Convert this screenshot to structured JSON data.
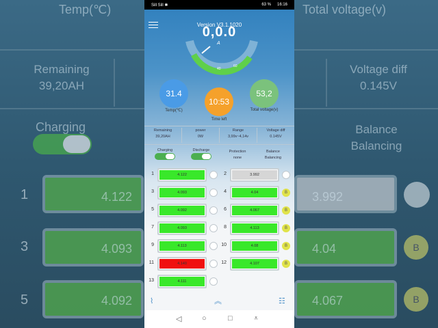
{
  "background": {
    "temp_label": "Temp(℃)",
    "total_voltage_label": "Total voltage(v)",
    "remaining_label": "Remaining",
    "remaining_value": "39,20AH",
    "voltage_diff_label": "Voltage diff",
    "voltage_diff_value": "0.145V",
    "charging_label": "Charging",
    "balance_label": "Balance",
    "balance_value": "Balancing",
    "row_numbers": [
      "1",
      "3",
      "5"
    ],
    "cells_left": [
      "4.122",
      "4.093",
      "4.092"
    ],
    "cells_right": [
      "3.992",
      "4.04",
      "4.067"
    ],
    "balance_badge": "B"
  },
  "status_bar": {
    "signal": "Sill Sill ✱",
    "battery": "63 %",
    "time": "16:16"
  },
  "header": {
    "version": "Version V3.1.1020"
  },
  "gauge": {
    "value": "0,0.0",
    "unit": "A",
    "tick_labels": [
      "40",
      "60"
    ],
    "fill_fraction": 0.55
  },
  "circles": {
    "temp": {
      "value": "31.4",
      "label": "Temp(℃)"
    },
    "time_left": {
      "value": "10:53",
      "label": "Time left"
    },
    "total_voltage": {
      "value": "53,2",
      "label": "Total voltage(v)"
    }
  },
  "info": {
    "remaining": {
      "label": "Remaining",
      "value": "39,20AH"
    },
    "power": {
      "label": "power",
      "value": "0W"
    },
    "range": {
      "label": "Range",
      "value": "3,99v~4,14v"
    },
    "voltage_diff": {
      "label": "Voltage diff",
      "value": "0.145V"
    }
  },
  "controls": {
    "charging": {
      "label": "Charging",
      "on": true
    },
    "discharge": {
      "label": "Discharge",
      "on": true
    },
    "protection": {
      "label": "Protection",
      "value": "none"
    },
    "balance": {
      "label": "Balance",
      "value": "Balancing"
    }
  },
  "cells": [
    {
      "num": "1",
      "value": "4.122",
      "state": "normal",
      "badge": ""
    },
    {
      "num": "2",
      "value": "3.992",
      "state": "gray",
      "badge": ""
    },
    {
      "num": "3",
      "value": "4.093",
      "state": "normal",
      "badge": ""
    },
    {
      "num": "4",
      "value": "4.04",
      "state": "normal",
      "badge": "B"
    },
    {
      "num": "5",
      "value": "4.092",
      "state": "normal",
      "badge": ""
    },
    {
      "num": "6",
      "value": "4.067",
      "state": "normal",
      "badge": "B"
    },
    {
      "num": "7",
      "value": "4.093",
      "state": "normal",
      "badge": ""
    },
    {
      "num": "8",
      "value": "4.113",
      "state": "normal",
      "badge": "B"
    },
    {
      "num": "9",
      "value": "4.113",
      "state": "normal",
      "badge": ""
    },
    {
      "num": "10",
      "value": "4.08",
      "state": "normal",
      "badge": "B"
    },
    {
      "num": "11",
      "value": "4.140",
      "state": "red",
      "badge": ""
    },
    {
      "num": "12",
      "value": "4.107",
      "state": "normal",
      "badge": "B"
    },
    {
      "num": "13",
      "value": "4.111",
      "state": "normal",
      "badge": ""
    }
  ],
  "bottom_bar": {
    "left_icon": "activity-icon",
    "center_icon": "double-chevron-up-icon",
    "right_icon": "settings-sliders-icon"
  },
  "navbar": {
    "back": "◁",
    "home": "○",
    "recents": "□",
    "download": "⩡"
  },
  "colors": {
    "cell_green": "#39e82a",
    "cell_red": "#f01010",
    "cell_gray": "#d6d6d6",
    "temp_circle": "#4a9be6",
    "time_circle": "#f5a12b",
    "voltage_circle": "#7bc27c",
    "balance_badge": "#e0e34a"
  }
}
